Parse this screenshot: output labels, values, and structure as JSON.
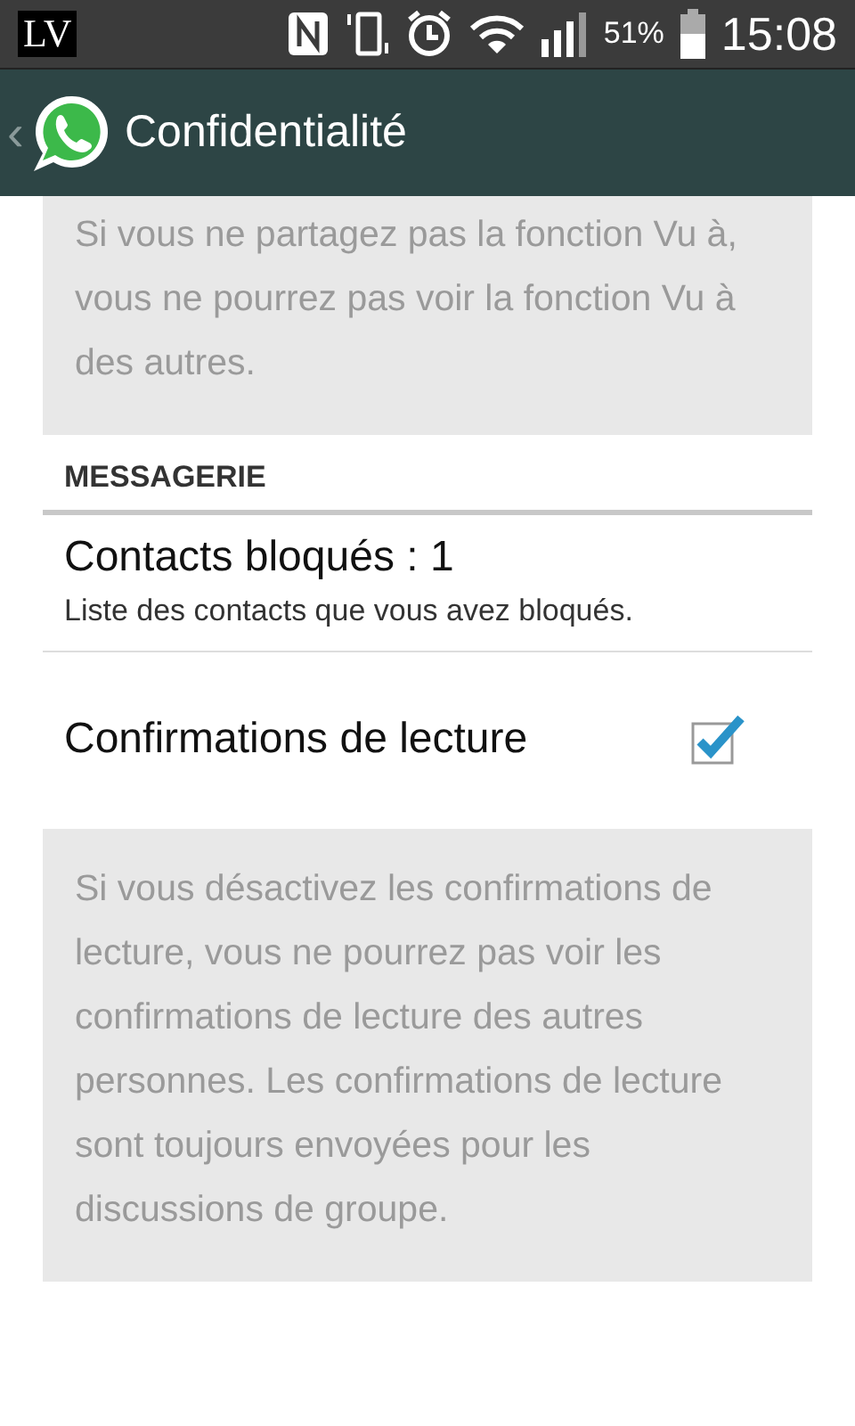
{
  "status_bar": {
    "badge": "LV",
    "battery": "51%",
    "time": "15:08"
  },
  "header": {
    "back": "‹",
    "title": "Confidentialité"
  },
  "items": [
    {
      "kind": "note",
      "text": "Si vous ne partagez pas la fonction Vu à, vous ne pourrez pas voir la fonction Vu à des autres."
    },
    {
      "kind": "section",
      "text": "MESSAGERIE"
    },
    {
      "kind": "entry",
      "title": "Contacts bloqués : 1",
      "summary": "Liste des contacts que vous avez bloqués."
    },
    {
      "kind": "toggle",
      "title": "Confirmations de lecture",
      "checked": true
    },
    {
      "kind": "note",
      "text": "Si vous désactivez les confirmations de lecture, vous ne pourrez pas voir les confirmations de lecture des autres personnes. Les confirmations de lecture sont toujours envoyées pour les discussions de groupe."
    }
  ]
}
